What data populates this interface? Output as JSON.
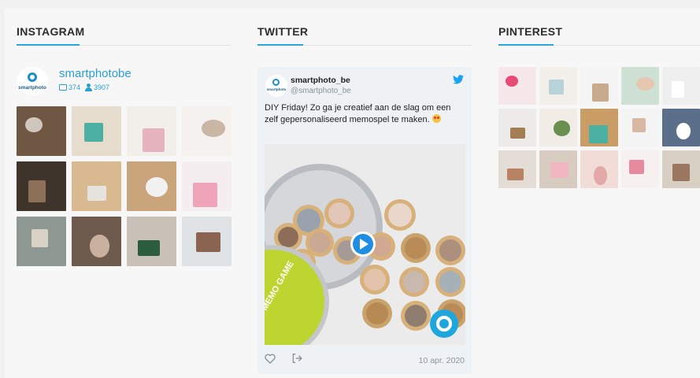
{
  "sections": {
    "instagram": {
      "title": "INSTAGRAM"
    },
    "twitter": {
      "title": "TWITTER"
    },
    "pinterest": {
      "title": "PINTEREST"
    }
  },
  "instagram": {
    "logo_text": "smartphoto",
    "username": "smartphotobe",
    "posts_count": "374",
    "followers_count": "3907",
    "tiles": [
      {
        "bg": "#6f5744",
        "accent": "#cfc7bb"
      },
      {
        "bg": "#e6dccd",
        "accent": "#4bb0a2"
      },
      {
        "bg": "#f2eeea",
        "accent": "#e7b3be"
      },
      {
        "bg": "#f4f1ee",
        "accent": "#c9b6a4"
      },
      {
        "bg": "#3e342c",
        "accent": "#8c7158"
      },
      {
        "bg": "#d9b98f",
        "accent": "#e6e3de"
      },
      {
        "bg": "#caa57b",
        "accent": "#f1f1f1"
      },
      {
        "bg": "#f5eef0",
        "accent": "#f0a4b9"
      },
      {
        "bg": "#8d9893",
        "accent": "#d8d1c6"
      },
      {
        "bg": "#6e5b4d",
        "accent": "#c8b29f"
      },
      {
        "bg": "#c9c1b7",
        "accent": "#2c5e3d"
      },
      {
        "bg": "#dfe3e5",
        "accent": "#8a6450"
      }
    ]
  },
  "twitter": {
    "logo_text": "smartphoto",
    "name": "smartphoto_be",
    "handle": "@smartphoto_be",
    "text": "DIY Friday! Zo ga je creatief aan de slag om een zelf gepersonaliseerd memospel te maken.",
    "tin_label": "MEMO GAME",
    "date": "10 apr. 2020",
    "colors": {
      "accent": "#1da1f2",
      "play": "#1f8ee2",
      "tin_lid": "#bcd531"
    }
  },
  "pinterest": {
    "tiles": [
      {
        "bg": "#f6e7ea",
        "accent": "#e84a76"
      },
      {
        "bg": "#f3efea",
        "accent": "#b7d2d8"
      },
      {
        "bg": "#f4f4f4",
        "accent": "#c8aa8c"
      },
      {
        "bg": "#cfe1d4",
        "accent": "#e5c7b2"
      },
      {
        "bg": "#efefef",
        "accent": "#ffffff"
      },
      {
        "bg": "#ecebea",
        "accent": "#a57d52"
      },
      {
        "bg": "#f1ede6",
        "accent": "#6b8f4f"
      },
      {
        "bg": "#c99d65",
        "accent": "#4bb0a2"
      },
      {
        "bg": "#f4f4f4",
        "accent": "#d7b9a3"
      },
      {
        "bg": "#5b6f8a",
        "accent": "#ffffff"
      },
      {
        "bg": "#e3ddd6",
        "accent": "#b88364"
      },
      {
        "bg": "#d7ccbf",
        "accent": "#f0b7c0"
      },
      {
        "bg": "#f1dcd7",
        "accent": "#e3a8a8"
      },
      {
        "bg": "#f6f1ee",
        "accent": "#e68aa0"
      },
      {
        "bg": "#d9d0c4",
        "accent": "#9b7660"
      }
    ]
  }
}
